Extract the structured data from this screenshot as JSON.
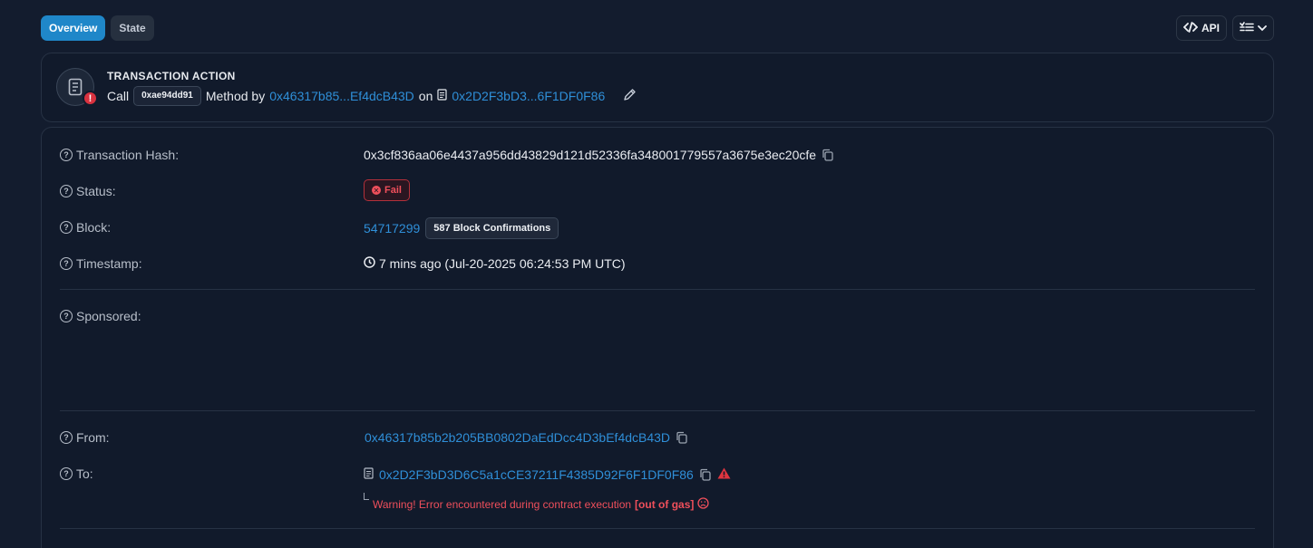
{
  "tabs": [
    {
      "label": "Overview",
      "active": true
    },
    {
      "label": "State",
      "active": false
    }
  ],
  "toolbar": {
    "api_label": "API"
  },
  "action": {
    "title": "TRANSACTION ACTION",
    "verb": "Call",
    "method_id": "0xae94dd91",
    "method_by": "Method by",
    "from_short": "0x46317b85...Ef4dcB43D",
    "on": "on",
    "to_short": "0x2D2F3bD3...6F1DF0F86",
    "alert_symbol": "!"
  },
  "details": {
    "tx_hash": {
      "label": "Transaction Hash:",
      "value": "0x3cf836aa06e4437a956dd43829d121d52336fa348001779557a3675e3ec20cfe"
    },
    "status": {
      "label": "Status:",
      "value": "Fail"
    },
    "block": {
      "label": "Block:",
      "number": "54717299",
      "confirmations": "587 Block Confirmations"
    },
    "timestamp": {
      "label": "Timestamp:",
      "value": "7 mins ago (Jul-20-2025 06:24:53 PM UTC)"
    },
    "sponsored": {
      "label": "Sponsored:"
    },
    "from": {
      "label": "From:",
      "value": "0x46317b85b2b205BB0802DaEdDcc4D3bEf4dcB43D"
    },
    "to": {
      "label": "To:",
      "value": "0x2D2F3bD3D6C5a1cCE37211F4385D92F6F1DF0F86"
    },
    "warning": {
      "text": "Warning! Error encountered during contract execution",
      "reason": "[out of gas]"
    }
  },
  "colors": {
    "accent": "#1f87c9",
    "link": "#2f8fd8",
    "error": "#ef4f5b",
    "background": "#131c2e"
  },
  "icons": [
    "code-icon",
    "list-icon",
    "chevron-down-icon",
    "document-icon",
    "alert-icon",
    "pencil-icon",
    "question-icon",
    "copy-icon",
    "x-circle-icon",
    "clock-icon",
    "warning-triangle-icon",
    "sad-face-icon"
  ]
}
